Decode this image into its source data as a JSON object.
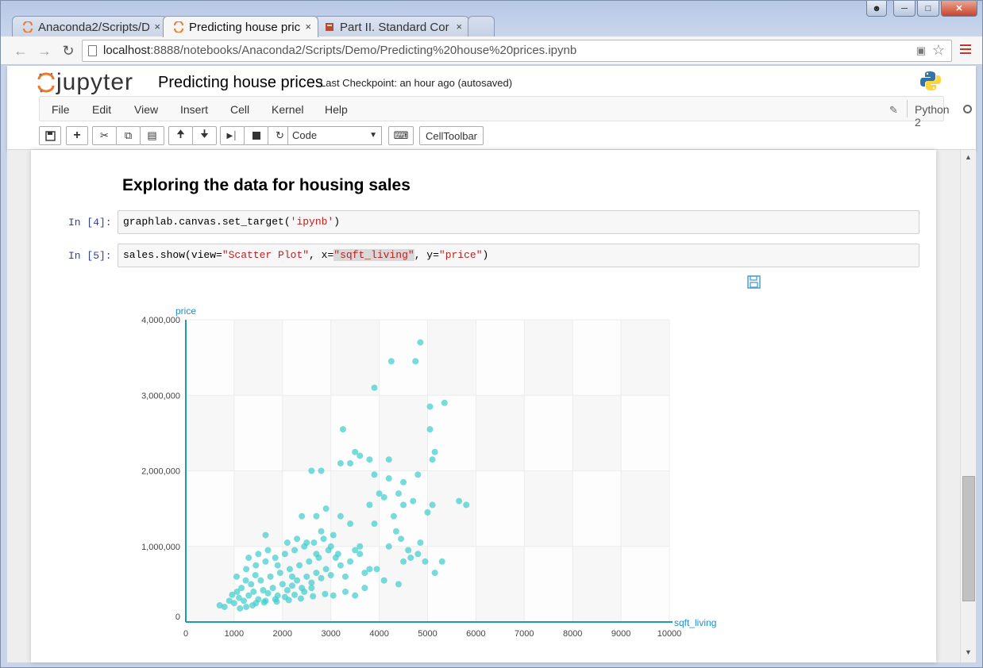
{
  "browser": {
    "tabs": [
      {
        "label": "Anaconda2/Scripts/D",
        "close": "×",
        "icon": "jupyter-tab-icon",
        "active": false
      },
      {
        "label": "Predicting house pric",
        "close": "×",
        "icon": "jupyter-tab-icon",
        "active": true
      },
      {
        "label": "Part II.  Standard Cor",
        "close": "×",
        "icon": "book-tab-icon",
        "active": false
      }
    ],
    "url_host": "localhost",
    "url_path": ":8888/notebooks/Anaconda2/Scripts/Demo/Predicting%20house%20prices.ipynb"
  },
  "jupyter": {
    "logo_text": "jupyter",
    "notebook_name": "Predicting house prices",
    "checkpoint": "Last Checkpoint: an hour ago (autosaved)",
    "menu": [
      "File",
      "Edit",
      "View",
      "Insert",
      "Cell",
      "Kernel",
      "Help"
    ],
    "kernel": "Python 2",
    "cell_type": "Code",
    "celltoolbar_label": "CellToolbar"
  },
  "cells": {
    "heading": "Exploring the data for housing sales",
    "cell1": {
      "prompt": "In  [4]:",
      "code_pre": "graphlab.canvas.set_target(",
      "code_str": "'ipynb'",
      "code_post": ")"
    },
    "cell2": {
      "prompt": "In  [5]:",
      "code_a": "sales.show(view=",
      "code_b": "\"Scatter Plot\"",
      "code_c": ", x=",
      "code_d": "\"sqft_living\"",
      "code_e": ", y=",
      "code_f": "\"price\"",
      "code_g": ")"
    }
  },
  "chart_data": {
    "type": "scatter",
    "xlabel": "sqft_living",
    "ylabel": "price",
    "xlim": [
      0,
      10000
    ],
    "ylim": [
      0,
      4000000
    ],
    "x_ticks": [
      "0",
      "1000",
      "2000",
      "3000",
      "4000",
      "5000",
      "6000",
      "7000",
      "8000",
      "9000",
      "10000"
    ],
    "y_ticks": [
      "0",
      "1,000,000",
      "2,000,000",
      "3,000,000",
      "4,000,000"
    ],
    "grid": true,
    "color": "#3fcccc",
    "points": [
      [
        1000,
        250000
      ],
      [
        1100,
        320000
      ],
      [
        1200,
        280000
      ],
      [
        1300,
        350000
      ],
      [
        1400,
        400000
      ],
      [
        1500,
        300000
      ],
      [
        1600,
        420000
      ],
      [
        1700,
        380000
      ],
      [
        1800,
        450000
      ],
      [
        1900,
        350000
      ],
      [
        2000,
        500000
      ],
      [
        2100,
        420000
      ],
      [
        2200,
        480000
      ],
      [
        2300,
        550000
      ],
      [
        2400,
        450000
      ],
      [
        2500,
        600000
      ],
      [
        2600,
        520000
      ],
      [
        2700,
        650000
      ],
      [
        2800,
        580000
      ],
      [
        2900,
        700000
      ],
      [
        3000,
        620000
      ],
      [
        800,
        200000
      ],
      [
        900,
        280000
      ],
      [
        700,
        220000
      ],
      [
        1150,
        450000
      ],
      [
        1350,
        500000
      ],
      [
        1550,
        550000
      ],
      [
        1750,
        600000
      ],
      [
        1950,
        650000
      ],
      [
        2150,
        700000
      ],
      [
        2350,
        750000
      ],
      [
        2550,
        800000
      ],
      [
        2750,
        850000
      ],
      [
        1250,
        200000
      ],
      [
        1450,
        250000
      ],
      [
        1650,
        280000
      ],
      [
        1850,
        300000
      ],
      [
        2050,
        330000
      ],
      [
        2250,
        360000
      ],
      [
        2450,
        400000
      ],
      [
        3200,
        750000
      ],
      [
        3400,
        800000
      ],
      [
        3600,
        900000
      ],
      [
        3800,
        700000
      ],
      [
        3300,
        600000
      ],
      [
        3500,
        950000
      ],
      [
        3100,
        850000
      ],
      [
        3700,
        650000
      ],
      [
        1050,
        600000
      ],
      [
        1250,
        700000
      ],
      [
        1450,
        750000
      ],
      [
        1650,
        800000
      ],
      [
        1850,
        850000
      ],
      [
        2050,
        900000
      ],
      [
        2250,
        950000
      ],
      [
        2450,
        1000000
      ],
      [
        2650,
        1050000
      ],
      [
        2850,
        1100000
      ],
      [
        3050,
        1150000
      ],
      [
        1650,
        1150000
      ],
      [
        2400,
        1400000
      ],
      [
        2700,
        1400000
      ],
      [
        2900,
        1500000
      ],
      [
        3200,
        1400000
      ],
      [
        3400,
        1300000
      ],
      [
        2800,
        1200000
      ],
      [
        3000,
        1000000
      ],
      [
        3600,
        1000000
      ],
      [
        3900,
        1300000
      ],
      [
        4100,
        1650000
      ],
      [
        4300,
        1400000
      ],
      [
        4500,
        1550000
      ],
      [
        4700,
        1600000
      ],
      [
        5000,
        1450000
      ],
      [
        5100,
        1550000
      ],
      [
        4000,
        1700000
      ],
      [
        3800,
        1550000
      ],
      [
        4400,
        1700000
      ],
      [
        2600,
        2000000
      ],
      [
        2800,
        2000000
      ],
      [
        3200,
        2100000
      ],
      [
        3400,
        2100000
      ],
      [
        3500,
        2250000
      ],
      [
        3600,
        2200000
      ],
      [
        3800,
        2150000
      ],
      [
        4200,
        2150000
      ],
      [
        3900,
        1950000
      ],
      [
        4200,
        1900000
      ],
      [
        4500,
        1850000
      ],
      [
        4800,
        1950000
      ],
      [
        5100,
        2150000
      ],
      [
        5150,
        2250000
      ],
      [
        5050,
        2550000
      ],
      [
        3250,
        2550000
      ],
      [
        3900,
        3100000
      ],
      [
        4250,
        3450000
      ],
      [
        4750,
        3450000
      ],
      [
        4850,
        3700000
      ],
      [
        5050,
        2850000
      ],
      [
        5350,
        2900000
      ],
      [
        5650,
        1600000
      ],
      [
        5800,
        1550000
      ],
      [
        5150,
        650000
      ],
      [
        4500,
        800000
      ],
      [
        4800,
        900000
      ],
      [
        4200,
        1000000
      ],
      [
        4600,
        950000
      ],
      [
        3950,
        700000
      ],
      [
        4100,
        550000
      ],
      [
        4400,
        500000
      ],
      [
        3700,
        450000
      ],
      [
        3500,
        350000
      ],
      [
        3300,
        400000
      ],
      [
        1700,
        950000
      ],
      [
        1500,
        900000
      ],
      [
        1300,
        850000
      ],
      [
        2100,
        1050000
      ],
      [
        2300,
        1100000
      ],
      [
        2500,
        1050000
      ],
      [
        1900,
        750000
      ],
      [
        2700,
        900000
      ],
      [
        2950,
        950000
      ],
      [
        3150,
        900000
      ],
      [
        2200,
        600000
      ],
      [
        2600,
        450000
      ],
      [
        3050,
        350000
      ],
      [
        4950,
        800000
      ],
      [
        4650,
        850000
      ],
      [
        5300,
        800000
      ],
      [
        4850,
        1050000
      ],
      [
        4450,
        1100000
      ],
      [
        4350,
        1200000
      ],
      [
        1120,
        180000
      ],
      [
        1380,
        220000
      ],
      [
        1620,
        260000
      ],
      [
        1880,
        270000
      ],
      [
        2130,
        290000
      ],
      [
        2380,
        310000
      ],
      [
        2630,
        340000
      ],
      [
        2880,
        370000
      ],
      [
        960,
        360000
      ],
      [
        1060,
        400000
      ],
      [
        1240,
        550000
      ],
      [
        1440,
        620000
      ]
    ]
  }
}
